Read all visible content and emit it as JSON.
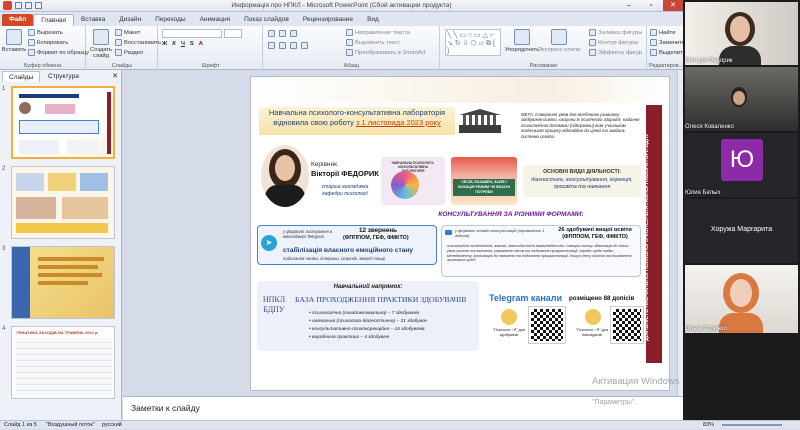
{
  "window": {
    "title": "Информація про НПКЛ - Microsoft PowerPoint (Сбой активации продукта)"
  },
  "tabs": [
    "Файл",
    "Главная",
    "Вставка",
    "Дизайн",
    "Переходы",
    "Анимация",
    "Показ слайдов",
    "Рецензирование",
    "Вид"
  ],
  "ribbon": {
    "clipboard": {
      "paste": "Вставить",
      "cut": "Вырезать",
      "copy": "Копировать",
      "format": "Формат по образцу",
      "label": "Буфер обмена"
    },
    "slides": {
      "new": "Создать слайд",
      "layout": "Макет",
      "reset": "Восстановить",
      "section": "Раздел",
      "label": "Слайды"
    },
    "font": {
      "label": "Шрифт"
    },
    "paragraph": {
      "text_dir": "Направление текста",
      "align": "Выровнять текст",
      "smartart": "Преобразовать в SmartArt",
      "label": "Абзац"
    },
    "drawing": {
      "arrange": "Упорядочить",
      "styles": "Экспресс-стили",
      "fill": "Заливка фигуры",
      "outline": "Контур фигуры",
      "effects": "Эффекты фигур",
      "label": "Рисование"
    },
    "editing": {
      "find": "Найти",
      "replace": "Заменить",
      "select": "Выделить",
      "label": "Редактиров..."
    }
  },
  "panel": {
    "tab_slides": "Слайды",
    "tab_outline": "Структура",
    "slide_numbers": [
      "1",
      "2",
      "3",
      "4"
    ],
    "thumb4_title": "ТЕМАТИКА ЗАХОДІВ НА ТРАВЕНЬ 2024 р."
  },
  "slide": {
    "title_line1": "Навчальна психолого-консультативна лабораторія",
    "title_line2": "відновила свою роботу",
    "title_date": "з 1 листопада 2023 року",
    "meta": "МЕТА: створення умов для всебічного розвитку здобувачів освіти, охорони їх психічного здоров'я, надання психологічної допомоги (підтримки) всім учасникам освітнього процесу відповідно до цілей та завдань системи освіти.",
    "head_label": "Керівник",
    "head_name": "Вікторії ФЕДОРИК",
    "head_role": "старша викладачка кафедри психології",
    "activities_title": "ОСНОВНІ ВИДИ ДІЯЛЬНОСТІ:",
    "activities_text": "діагностика, консультування, корекція, просвіта та навчання",
    "consult_title": "КОНСУЛЬТУВАННЯ ЗА РІЗНИМИ ФОРМАМИ:",
    "chat_format": "у форматі листування в месенджері Telegram",
    "chat_count": "12 звернень",
    "chat_faculty": "(ФПППОМ, ГЕФ, ФМКТО)",
    "chat_topic": "стабілізація власного емоційного стану",
    "chat_sub": "подолання паніки, істерики, страхів, зверсії тощо",
    "online_format": "у форматі онлайн-консультацій (тривалість 1 година)",
    "online_count": "26 здобувачі вищої освіти",
    "online_faculty": "(ФПППОМ, ГЕФ, ФМКТО)",
    "online_text": "психологічне висвітлення, апатія, міжособистісні взаємовідносини, самороз витку, адаптація до нових умов життя та навчання, управління часом та подолання прокрастинації, поради щодо тайм-менеджменту, мотивацію до навчання та подолання прокрастинації, пошук сенсу життя та визначення життєвих цілей",
    "edu_title": "Навчальний напрямок:",
    "edu_subtitle": "БАЗА ПРОХОДЖЕННЯ ПРАКТИКИ ЗДОБУВАЧІВ",
    "logo_text": "НПКЛ БДПУ",
    "edu_items": [
      "психологічна (ознайомлювальна) – 7 здобувачів",
      "навчальна (психолого-діагностична) – 31 здобувач",
      "консультативно-психокорекційна – 16 здобувачів",
      "виробнича практика – 4 здобувачі"
    ],
    "tg_title": "Telegram канали",
    "tg_count": "розміщено 88 допісів",
    "tg_ch1": "\"Психолог і Я\" для здобувачів",
    "tg_ch2": "\"Психолог і Я\" для викладачів",
    "vertical": "ДІЯЛЬНІСТЬ НАВЧАЛЬНОЇ ПСИХОЛОГО-КОНСУЛЬТАТИВНОЇ ЛАБОРАТОРІЇ БДПУ",
    "card1": "НАВЧАЛЬНА ПСИХОЛОГО-КОНСУЛЬТАТИВНА ЛАБОРАТОРІЯ",
    "card2": "СЕСІЯ, ЕКЗАМЕН, ЗАЛІК І БОКАЦІЯ РЕЖИМ ЧИ ВЛАСНІ ПОТРЕБИ"
  },
  "overlay": {
    "activation": "Активация Windows",
    "activation_sub": "\"Параметры\"."
  },
  "notes": {
    "placeholder": "Заметки к слайду"
  },
  "status": {
    "slide": "Слайд 1 из 5",
    "theme": "\"Воздушный поток\"",
    "lang": "русский",
    "zoom": "83%"
  },
  "participants": [
    {
      "name": "Вікторія Федорик"
    },
    {
      "name": "Олеся Коваленко"
    },
    {
      "name": "Юлия Белых",
      "initial": "Ю"
    },
    {
      "name": "Хоружа Маргарита"
    },
    {
      "name": "Ольга Стрижко"
    }
  ],
  "colors": {
    "file_tab": "#d24726",
    "slide_red": "#8b1e2b",
    "title_blue": "#1f3c7a",
    "telegram": "#2aa3d8",
    "initial_tile": "#8d2aa8"
  }
}
